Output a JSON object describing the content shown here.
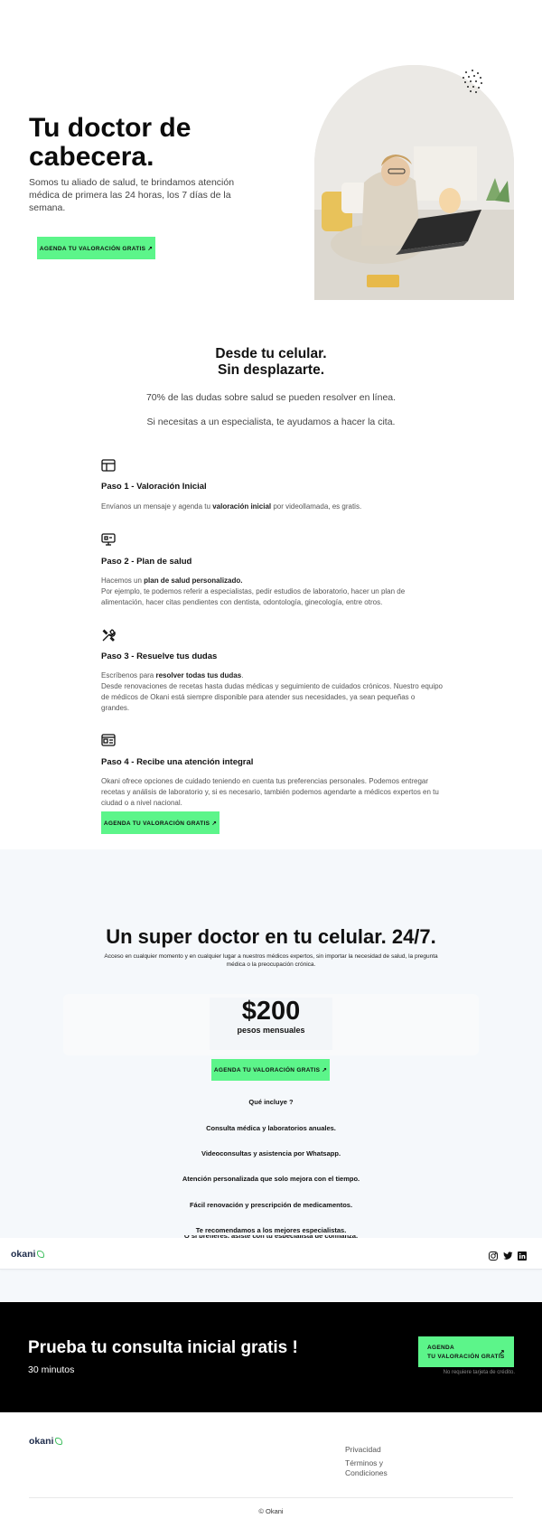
{
  "hero": {
    "title": "Tu doctor de cabecera.",
    "subtitle": "Somos tu aliado de salud, te brindamos atención médica de primera las 24 horas, los 7 días de la semana.",
    "cta": "AGENDA TU VALORACIÓN GRATIS ↗"
  },
  "intro": {
    "title_line1": "Desde tu celular.",
    "title_line2": "Sin desplazarte.",
    "line1": "70% de las dudas sobre salud se pueden resolver en línea.",
    "line2": "Si necesitas a un especialista, te ayudamos a hacer la cita."
  },
  "steps": [
    {
      "icon": "layout-icon",
      "title": "Paso 1 - Valoración Inicial",
      "text_pre": "Envíanos un mensaje y agenda tu ",
      "text_bold": "valoración inicial",
      "text_post": " por videollamada, es gratis."
    },
    {
      "icon": "monitor-icon",
      "title": "Paso 2 - Plan de salud",
      "text_pre": "Hacemos un ",
      "text_bold": "plan de salud personalizado.",
      "text_post": "Por ejemplo, te podemos referir a especialistas, pedir estudios de laboratorio, hacer un plan de alimentación, hacer citas pendientes con dentista, odontología, ginecología, entre otros."
    },
    {
      "icon": "tools-icon",
      "title": "Paso 3 - Resuelve tus dudas",
      "text_pre": "Escríbenos para ",
      "text_bold": "resolver todas tus dudas",
      "text_post": "Desde renovaciones de recetas hasta dudas médicas y seguimiento de cuidados crónicos. Nuestro equipo de médicos de Okani está siempre disponible para atender sus necesidades, ya sean pequeñas o grandes."
    },
    {
      "icon": "newspaper-icon",
      "title": "Paso 4 - Recibe una atención integral",
      "text": "Okani ofrece opciones de cuidado teniendo en cuenta tus preferencias personales. Podemos entregar recetas y análisis de laboratorio y, si es necesario, también podemos agendarte a médicos expertos en tu ciudad o a nivel nacional."
    }
  ],
  "steps_cta": "AGENDA TU VALORACIÓN GRATIS ↗",
  "pricing": {
    "title": "Un super doctor en tu celular. 24/7.",
    "subtitle": "Acceso en cualquier momento y en cualquier lugar a nuestros médicos expertos, sin importar la necesidad de salud, la pregunta médica o la preocupación crónica.",
    "price": "$200",
    "period": "pesos mensuales",
    "cta": "AGENDA TU VALORACIÓN GRATIS ↗",
    "includes_title": "Qué incluye ?",
    "includes": [
      "Consulta médica y laboratorios anuales.",
      "Videoconsultas y asistencia por Whatsapp.",
      "Atención personalizada que solo mejora con el tiempo.",
      "Fácil renovación y prescripción de medicamentos.",
      "Te recomendamos a los mejores especialistas."
    ],
    "includes_cut": "O si prefieres, asiste con tu especialista de confianza."
  },
  "navbar": {
    "logo": "okani",
    "social": [
      "instagram-icon",
      "twitter-icon",
      "linkedin-icon"
    ]
  },
  "banner": {
    "title": "Prueba tu consulta inicial gratis !",
    "subtitle": "30 minutos",
    "cta_line1": "AGENDA",
    "cta_line2": "TU VALORACIÓN GRATIS",
    "cta_arrow": "↗",
    "note": "No requiere tarjeta de crédito."
  },
  "footer": {
    "logo": "okani",
    "link_privacy": "Privacidad",
    "link_terms_1": "Términos y",
    "link_terms_2": "Condiciones",
    "copyright": "© Okani"
  },
  "colors": {
    "accent": "#5cf58a",
    "pricing_bg": "#f5f8fb",
    "logo": "#1d2b4a"
  }
}
